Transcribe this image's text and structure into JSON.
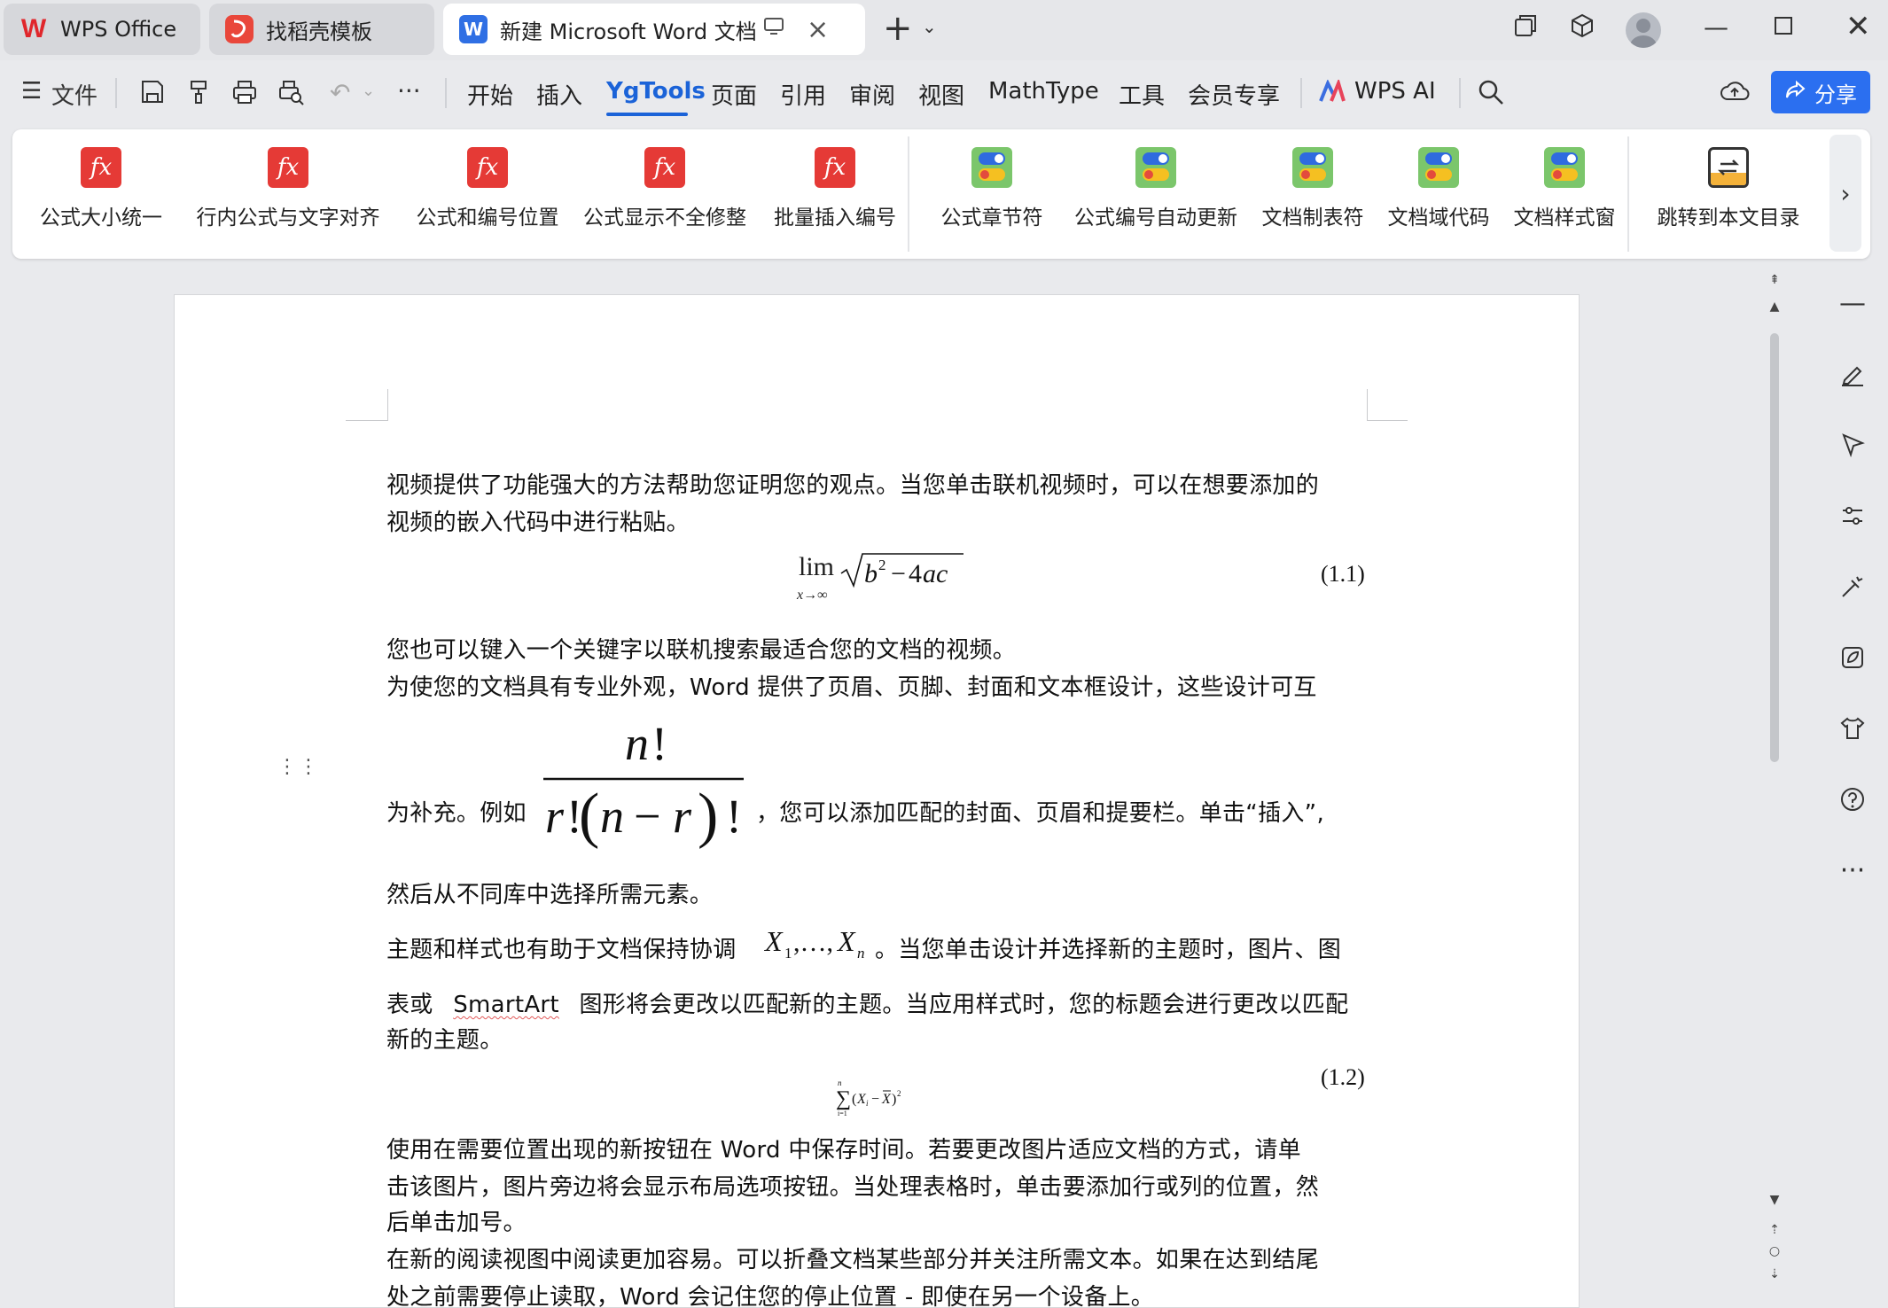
{
  "tabs": [
    {
      "label": "WPS Office",
      "icon": "wps-logo-icon"
    },
    {
      "label": "找稻壳模板",
      "icon": "daoke-logo-icon"
    },
    {
      "label": "新建 Microsoft Word 文档.doc",
      "icon": "word-doc-icon"
    }
  ],
  "toolbar": {
    "file_label": "文件"
  },
  "menu": [
    "开始",
    "插入",
    "YgTools",
    "页面",
    "引用",
    "审阅",
    "视图",
    "MathType",
    "工具",
    "会员专享",
    "WPS AI"
  ],
  "share_label": "分享",
  "ribbon": {
    "group1": [
      "公式大小统一",
      "行内公式与文字对齐",
      "公式和编号位置",
      "公式显示不全修整",
      "批量插入编号"
    ],
    "group2": [
      "公式章节符",
      "公式编号自动更新",
      "文档制表符",
      "文档域代码",
      "文档样式窗"
    ],
    "group3": [
      "跳转到本文目录"
    ]
  },
  "document": {
    "p1a": "视频提供了功能强大的方法帮助您证明您的观点。当您单击联机视频时，可以在想要添加的",
    "p1b": "视频的嵌入代码中进行粘贴。",
    "eq1_lim": "lim",
    "eq1_sub": "x→∞",
    "eq1_num": "(1.1)",
    "p2": "您也可以键入一个关键字以联机搜索最适合您的文档的视频。",
    "p3a": "为使您的文档具有专业外观，Word 提供了页眉、页脚、封面和文本框设计，这些设计可互",
    "p3b_pre": "为补充。例如",
    "p3b_post": "，您可以添加匹配的封面、页眉和提要栏。单击“插入”,",
    "p3c": "然后从不同库中选择所需元素。",
    "p4a_pre": "主题和样式也有助于文档保持协调",
    "p4a_post": "。当您单击设计并选择新的主题时，图片、图",
    "p4b_pre": "表或",
    "p4b_smart": "SmartArt",
    "p4b_post": "图形将会更改以匹配新的主题。当应用样式时，您的标题会进行更改以匹配",
    "p4c": "新的主题。",
    "eq2_num": "(1.2)",
    "p5a": "使用在需要位置出现的新按钮在  Word  中保存时间。若要更改图片适应文档的方式，请单",
    "p5b": "击该图片，图片旁边将会显示布局选项按钮。当处理表格时，单击要添加行或列的位置，然",
    "p5c": "后单击加号。",
    "p6a": "在新的阅读视图中阅读更加容易。可以折叠文档某些部分并关注所需文本。如果在达到结尾",
    "p6b": "处之前需要停止读取，Word 会记住您的停止位置 - 即使在另一个设备上。"
  },
  "colors": {
    "accent": "#1b63d8",
    "share": "#2b6ff0",
    "fx_icon": "#e53a36",
    "toggle_icon_bg": "#7bc66b"
  }
}
